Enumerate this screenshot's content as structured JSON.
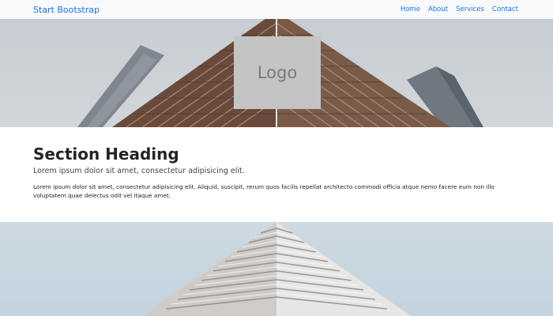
{
  "navbar": {
    "brand": "Start Bootstrap",
    "links": [
      {
        "label": "Home"
      },
      {
        "label": "About"
      },
      {
        "label": "Services"
      },
      {
        "label": "Contact"
      }
    ]
  },
  "hero1": {
    "logo_text": "Logo"
  },
  "section": {
    "heading": "Section Heading",
    "lead": "Lorem ipsum dolor sit amet, consectetur adipisicing elit.",
    "body": "Lorem ipsum dolor sit amet, consectetur adipisicing elit. Aliquid, suscipit, rerum quos facilis repellat architecto commodi officia atque nemo facere eum non illo voluptatem quae delectus odit vel itaque amet."
  },
  "colors": {
    "link": "#1a73e8",
    "navbar_bg": "#f8f9fa",
    "logo_bg": "#c4c4c4"
  }
}
